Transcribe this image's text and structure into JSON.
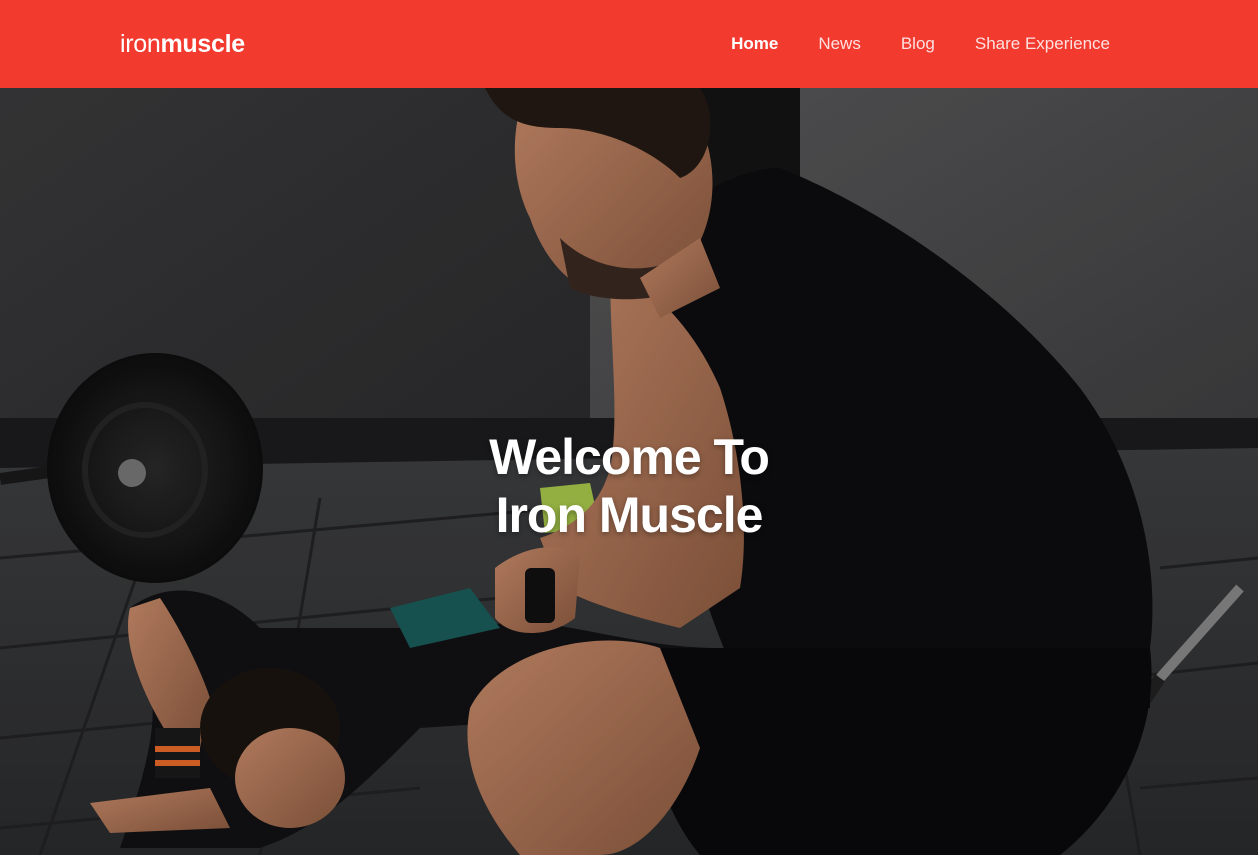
{
  "brand": {
    "part1": "iron",
    "part2": "muscle"
  },
  "nav": {
    "items": [
      {
        "label": "Home",
        "active": true
      },
      {
        "label": "News",
        "active": false
      },
      {
        "label": "Blog",
        "active": false
      },
      {
        "label": "Share Experience",
        "active": false
      }
    ]
  },
  "hero": {
    "line1": "Welcome To",
    "line2": "Iron Muscle",
    "image": "gym-trainer-photo"
  },
  "colors": {
    "accent": "#f23a2f",
    "text": "#ffffff"
  }
}
